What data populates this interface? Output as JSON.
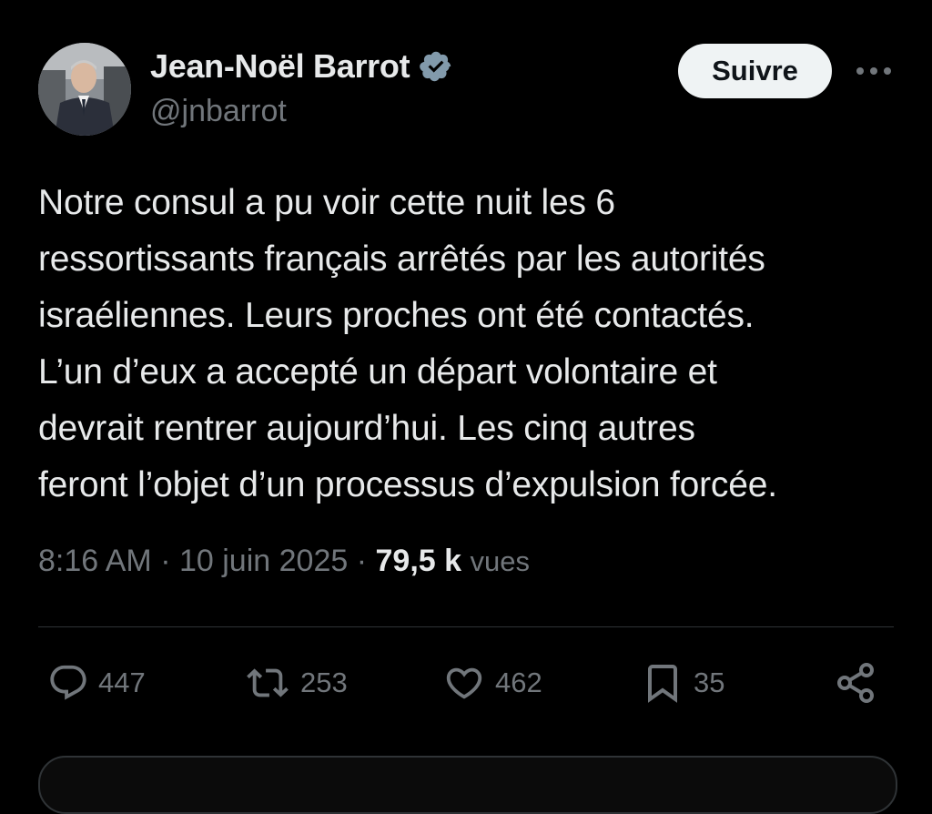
{
  "author": {
    "name": "Jean-Noël Barrot",
    "handle": "@jnbarrot",
    "verified": true
  },
  "header": {
    "follow_label": "Suivre"
  },
  "tweet": {
    "text": "Notre consul a pu voir cette nuit les 6\nressortissants français arrêtés par les autorités\nisraéliennes. Leurs proches ont été contactés.\nL’un d’eux a accepté un départ volontaire et\ndevrait rentrer aujourd’hui. Les cinq autres\nferont l’objet d’un processus d’expulsion forcée.",
    "time": "8:16 AM",
    "separator": "·",
    "date": "10 juin 2025",
    "views_count": "79,5 k",
    "views_label": "vues"
  },
  "actions": {
    "replies": "447",
    "reposts": "253",
    "likes": "462",
    "bookmarks": "35"
  },
  "colors": {
    "background": "#000000",
    "text_primary": "#e7e9ea",
    "text_secondary": "#71767b",
    "divider": "#2f3336",
    "follow_bg": "#eff3f4",
    "verified": "#829aab"
  },
  "icons": {
    "more": "more-horizontal-icon",
    "verified": "verified-badge-icon",
    "reply": "comment-icon",
    "repost": "repost-icon",
    "like": "heart-icon",
    "bookmark": "bookmark-icon",
    "share": "share-icon"
  }
}
